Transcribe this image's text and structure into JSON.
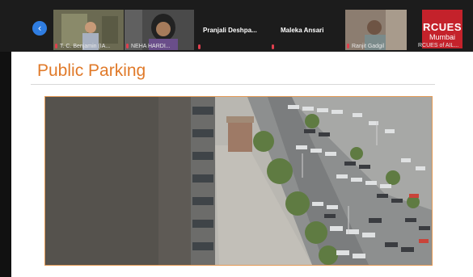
{
  "meeting": {
    "participants": [
      {
        "name": "T. C. Benjamin (IA..."
      },
      {
        "name": "NEHA HARDI..."
      },
      {
        "name": "Pranjali Deshpa..."
      },
      {
        "name": "Maleka Ansari"
      },
      {
        "name": "Ranjit Gadgil"
      },
      {
        "name": "RCUES of AIL..."
      }
    ],
    "logo_text": {
      "line1": "RCUES",
      "line2": "Mumbai"
    },
    "back_icon": "chevron-left-icon"
  },
  "slide": {
    "title": "Public Parking",
    "title_color": "#e07a2a"
  },
  "colors": {
    "mic_muted": "#e0404e",
    "accent_blue": "#2f7de1"
  }
}
